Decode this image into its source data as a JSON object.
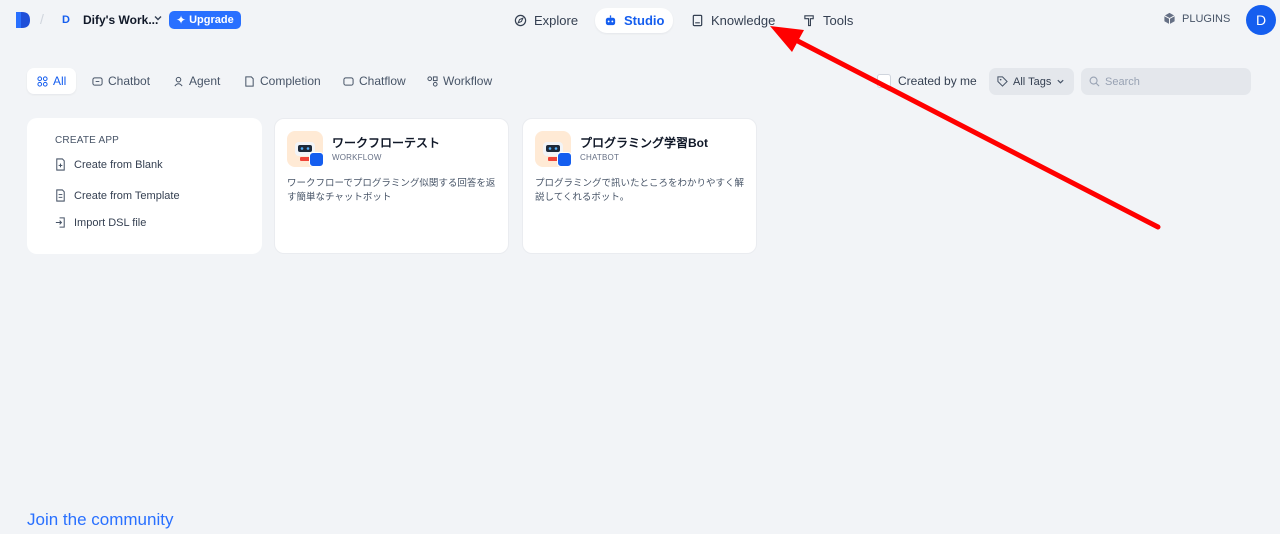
{
  "header": {
    "workspace_initial": "D",
    "workspace_name": "Dify's Work...",
    "upgrade_label": "Upgrade",
    "nav": [
      {
        "label": "Explore",
        "icon": "compass-icon"
      },
      {
        "label": "Studio",
        "icon": "robot-icon"
      },
      {
        "label": "Knowledge",
        "icon": "book-icon"
      },
      {
        "label": "Tools",
        "icon": "hammer-icon"
      }
    ],
    "plugins_label": "PLUGINS",
    "user_initial": "D"
  },
  "tabs": [
    {
      "label": "All",
      "icon": "grid-icon"
    },
    {
      "label": "Chatbot",
      "icon": "chat-icon"
    },
    {
      "label": "Agent",
      "icon": "agent-icon"
    },
    {
      "label": "Completion",
      "icon": "doc-icon"
    },
    {
      "label": "Chatflow",
      "icon": "chatflow-icon"
    },
    {
      "label": "Workflow",
      "icon": "workflow-icon"
    }
  ],
  "filters": {
    "created_by_me": "Created by me",
    "all_tags": "All Tags",
    "search_placeholder": "Search"
  },
  "create_app": {
    "title": "CREATE APP",
    "items": [
      "Create from Blank",
      "Create from Template",
      "Import DSL file"
    ]
  },
  "apps": [
    {
      "name": "ワークフローテスト",
      "type": "WORKFLOW",
      "description": "ワークフローでプログラミング似関する回答を返す簡単なチャットボット"
    },
    {
      "name": "プログラミング学習Bot",
      "type": "CHATBOT",
      "description": "プログラミングで訊いたところをわかりやすく解説してくれるボット。"
    }
  ],
  "footer": {
    "community": "Join the community"
  },
  "colors": {
    "accent": "#155eef",
    "upgrade": "#2970ff",
    "annotation_arrow": "#ff0000"
  }
}
